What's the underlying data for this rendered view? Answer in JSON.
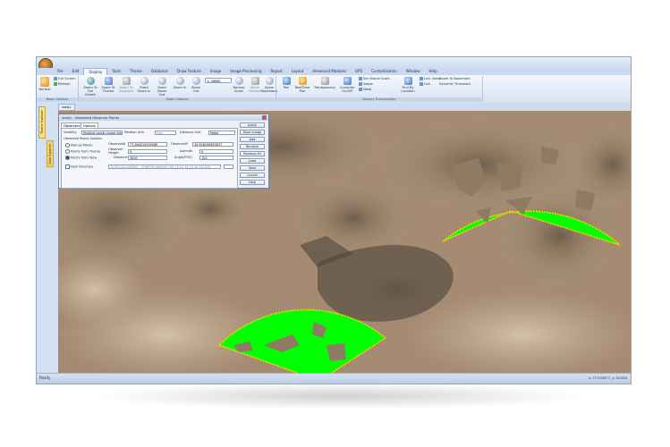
{
  "menu": [
    "File",
    "Edit",
    "Display",
    "Tools",
    "Theme",
    "Database",
    "Draw Feature",
    "Image",
    "Image Processing",
    "Report",
    "Layout",
    "Advanced Modules",
    "GPS",
    "Customization",
    "Window",
    "Help"
  ],
  "active_menu": "Display",
  "ribbon": {
    "basic_options_label": "Basic Options",
    "zoom_options_label": "Zoom Options",
    "display_functionality_label": "Display Functionality",
    "normal": "Normal",
    "full_screen": "Full Screen",
    "refresh": "Refresh",
    "zoom_full_extent": "Zoom To Full Extent",
    "zoom_theme": "Zoom To Theme",
    "zoom_selected": "Zoom To Selected",
    "fixed_zoom_in": "Fixed Zoom In",
    "fixed_zoom_out": "Fixed Zoom Out",
    "zoom_in": "Zoom In",
    "zoom_out": "Zoom Out",
    "scale_value": "1: 26861",
    "normal_scale": "Normal Scale",
    "zoom_forward": "Zoom Forward",
    "zoom_backward": "Zoom Backward",
    "pan": "Pan",
    "realtime_pan": "RealTime Pan",
    "transparency": "Transparency",
    "crosshair": "Crosshair On/Off",
    "set_visible_scale": "Set Visible Scale",
    "swipe": "Swipe",
    "mask": "Mask",
    "find_by_location": "Find By Location",
    "link_views": "Link Views",
    "link": "Link",
    "zoom_to_bookmark": "Zoom To Bookmark",
    "dynamic_threshold": "Dynamic Threshold"
  },
  "left_tabs": [
    "Theme Explorer",
    "Data Explorer"
  ],
  "doc_tab": "view1",
  "dialog": {
    "title": "view1 : Viewshed Observer Points",
    "tab_observers": "Observers",
    "tab_options": "Options",
    "visibility_label": "Visibility",
    "visibility_value": "Multiple points single view",
    "position_unit_label": "Position Unit",
    "position_unit_value": "Map",
    "distance_unit_label": "Distance Unit",
    "distance_unit_value": "Meter",
    "observed_points_options": "Observed Points Options",
    "manual_points": "Manual Points",
    "points_from_theme": "Points from Theme",
    "points_from_view": "Points from View",
    "observed_x_label": "ObservedX",
    "observed_x_value": "77.564010509289",
    "observed_y_label": "ObservedY",
    "observed_y_value": "34.958190852637",
    "observer_height_label": "Observer Height",
    "observer_height_value": "5",
    "azimuth_label": "Azimuth",
    "azimuth_value": "0",
    "distance_label": "Distance",
    "distance_value": "3000",
    "angle_fov_label": "Angle(FOV)",
    "angle_fov_value": "120",
    "dem_directory_label": "Dem Directory",
    "coords_value": "74747101.529000 - 2746750.090500 255 15 15 15 15 15 247474",
    "buttons": [
      "Apply",
      "Save Image",
      "Add",
      "Remove",
      "Remove All",
      "Load",
      "Save",
      "Cancel",
      "Help"
    ]
  },
  "status": {
    "left": "Ready",
    "right": "x: 77.533677,  y: 34.584"
  },
  "colors": {
    "viewshed": "#00ff00",
    "viewshed_outline": "#ffd400"
  }
}
